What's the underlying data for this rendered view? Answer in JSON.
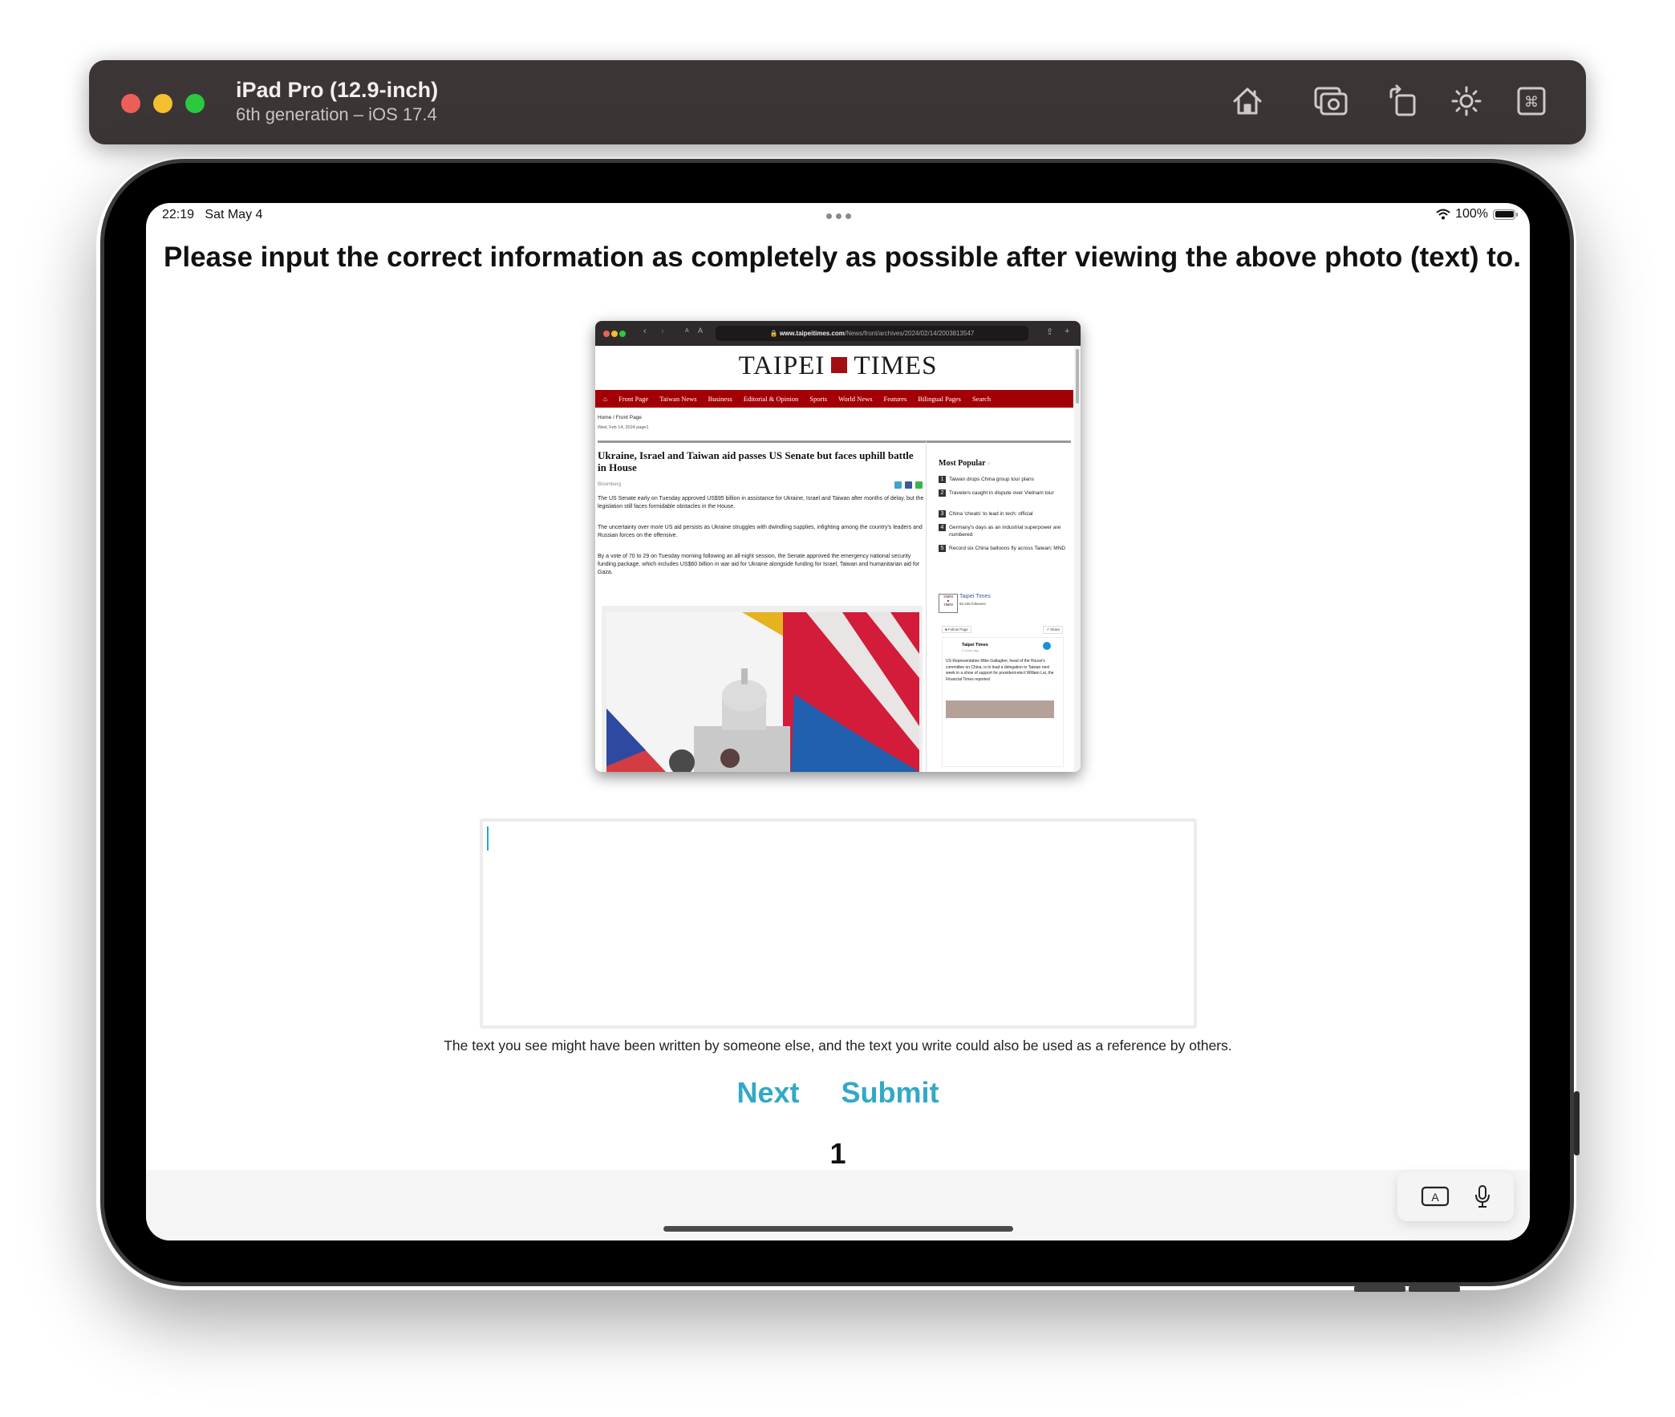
{
  "simulator": {
    "title": "iPad Pro (12.9-inch)",
    "subtitle": "6th generation – iOS 17.4",
    "toolbar_icons": [
      "home-icon",
      "screenshot-icon",
      "rotate-icon",
      "appearance-icon",
      "command-icon"
    ]
  },
  "status_bar": {
    "time": "22:19",
    "date": "Sat May 4",
    "battery": "100%"
  },
  "question": {
    "title": "Please input the correct information as completely as possible after viewing the above photo (text) to..."
  },
  "embedded_screenshot": {
    "url_domain": "www.taipeitimes.com",
    "url_path": "/News/front/archives/2024/02/14/2003813547",
    "logo_left": "TAIPEI",
    "logo_right": "TIMES",
    "nav": [
      "Front Page",
      "Taiwan News",
      "Business",
      "Editorial & Opinion",
      "Sports",
      "World News",
      "Features",
      "Bilingual Pages",
      "Search"
    ],
    "breadcrumb": "Home / Front Page",
    "dateline": "Wed, Feb 14, 2024 page1",
    "headline": "Ukraine, Israel and Taiwan aid passes US Senate but faces uphill battle in House",
    "byline": "Bloomberg",
    "paragraphs": [
      "The US Senate early on Tuesday approved US$95 billion in assistance for Ukraine, Israel and Taiwan after months of delay, but the legislation still faces formidable obstacles in the House.",
      "The uncertainty over more US aid persists as Ukraine struggles with dwindling supplies, infighting among the country's leaders and Russian forces on the offensive.",
      "By a vote of 70 to 29 on Tuesday morning following an all-night session, the Senate approved the emergency national security funding package, which includes US$60 billion in war aid for Ukraine alongside funding for Israel, Taiwan and humanitarian aid for Gaza."
    ],
    "most_popular": {
      "title": "Most Popular",
      "items": [
        {
          "num": "1",
          "text": "Taiwan drops China group tour plans"
        },
        {
          "num": "2",
          "text": "Travelers caught in dispute over Vietnam tour"
        },
        {
          "num": "3",
          "text": "China 'cheats' to lead in tech: official"
        },
        {
          "num": "4",
          "text": "Germany's days as an industrial superpower are numbered"
        },
        {
          "num": "5",
          "text": "Record six China balloons fly across Taiwan: MND"
        }
      ]
    },
    "facebook": {
      "page_name": "Taipei Times",
      "followers": "60,436 followers",
      "follow_label": "Follow Page",
      "share_label": "Share",
      "post_author": "Taipei Times",
      "post_time": "2 hours ago",
      "post_text": "US Representative Mike Gallagher, head of the House's committee on China, is to lead a delegation to Taiwan next week in a show of support for president-elect William Lai, the Financial Times reported"
    }
  },
  "answer": {
    "value": "",
    "placeholder": ""
  },
  "disclaimer": "The text you see might have been written by someone else, and the text you write could also be used as a reference by others.",
  "buttons": {
    "next": "Next",
    "submit": "Submit"
  },
  "page_number": "1",
  "colors": {
    "accent": "#32a9c6",
    "nav_red": "#a30006",
    "toolbar_bg": "#3b3536"
  }
}
